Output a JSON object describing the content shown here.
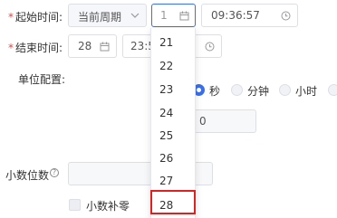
{
  "row1": {
    "label": "起始时间:",
    "period_select": "当前周期",
    "day_value": "1",
    "time_value": "09:36:57"
  },
  "row2": {
    "label": "结束时间:",
    "day_value": "28",
    "time_value": "23:5"
  },
  "unit": {
    "label": "单位配置:",
    "options": [
      "秒",
      "分钟",
      "小时"
    ],
    "selected": "秒",
    "value": "0"
  },
  "decimal": {
    "label": "小数位数",
    "checkbox_label": "小数补零"
  },
  "dropdown": {
    "options": [
      "21",
      "22",
      "23",
      "24",
      "25",
      "26",
      "27",
      "28"
    ],
    "highlighted": "28"
  },
  "colors": {
    "accent": "#3b6fe8",
    "required": "#e64545",
    "highlight_box": "#e02020"
  },
  "icons": [
    "calendar-icon",
    "clock-icon",
    "chevron-down-icon",
    "help-icon"
  ]
}
